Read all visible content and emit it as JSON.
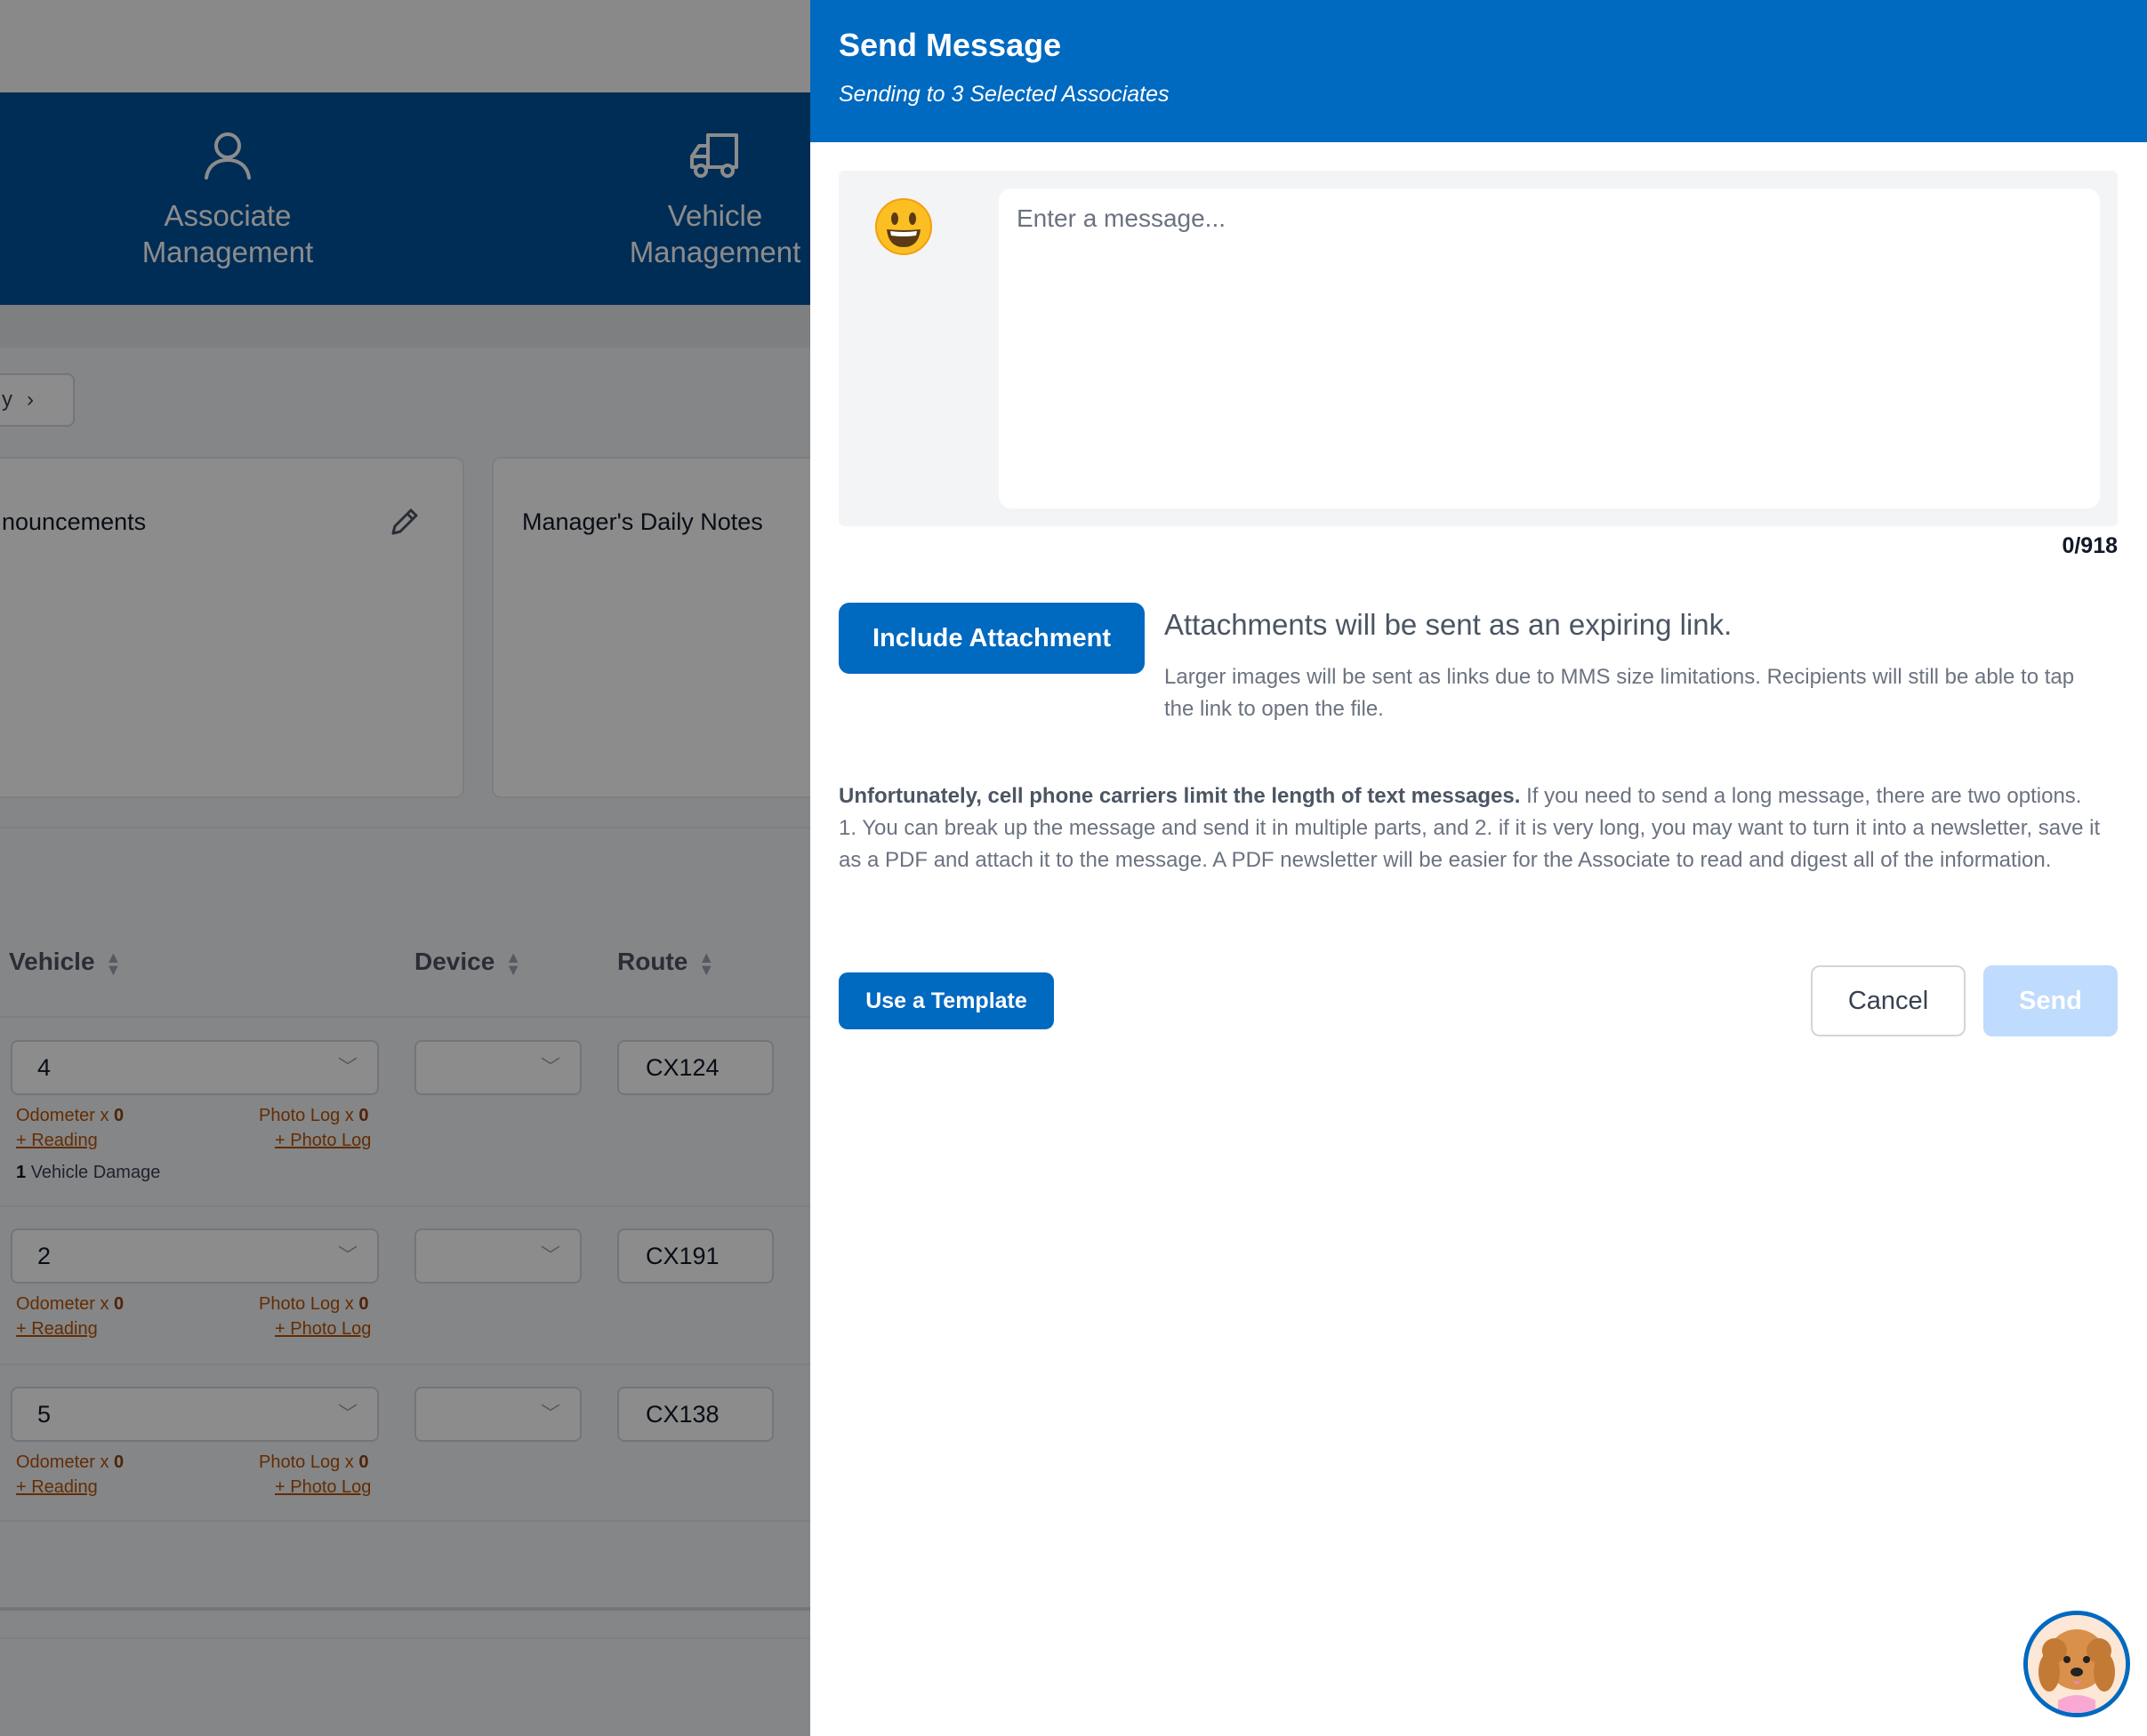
{
  "background": {
    "nav": [
      {
        "label": "Associate\nManagement",
        "icon": "user-icon"
      },
      {
        "label": "Vehicle\nManagement",
        "icon": "truck-icon"
      }
    ],
    "breadcrumb": {
      "label": "y",
      "chevron": "›"
    },
    "cards": [
      {
        "title": "nouncements"
      },
      {
        "title": "Manager's Daily Notes"
      }
    ],
    "table": {
      "headers": [
        "Vehicle",
        "Device",
        "Route"
      ],
      "rows": [
        {
          "vehicle": "4",
          "route": "CX124",
          "odometer_label": "Odometer x",
          "odometer_count": "0",
          "photo_label": "Photo Log x",
          "photo_count": "0",
          "reading_link": "+ Reading",
          "photo_link": "+ Photo Log",
          "damage_count": "1",
          "damage_label": "Vehicle Damage"
        },
        {
          "vehicle": "2",
          "route": "CX191",
          "odometer_label": "Odometer x",
          "odometer_count": "0",
          "photo_label": "Photo Log x",
          "photo_count": "0",
          "reading_link": "+ Reading",
          "photo_link": "+ Photo Log"
        },
        {
          "vehicle": "5",
          "route": "CX138",
          "odometer_label": "Odometer x",
          "odometer_count": "0",
          "photo_label": "Photo Log x",
          "photo_count": "0",
          "reading_link": "+ Reading",
          "photo_link": "+ Photo Log"
        }
      ]
    }
  },
  "drawer": {
    "title": "Send Message",
    "subtitle": "Sending to 3 Selected Associates",
    "message": {
      "placeholder": "Enter a message...",
      "value": "",
      "counter": "0/918",
      "emoji_icon": "smiley-face-icon"
    },
    "attachment": {
      "button_label": "Include Attachment",
      "title": "Attachments will be sent as an expiring link.",
      "description": "Larger images will be sent as links due to MMS size limitations. Recipients will still be able to tap the link to open the file."
    },
    "limit_note": {
      "bold": "Unfortunately, cell phone carriers limit the length of text messages.",
      "text": " If you need to send a long message, there are two options. 1. You can break up the message and send it in multiple parts, and 2. if it is very long, you may want to turn it into a newsletter, save it as a PDF and attach it to the message. A PDF newsletter will be easier for the Associate to read and digest all of the information."
    },
    "template_button": "Use a Template",
    "cancel_button": "Cancel",
    "send_button": "Send",
    "helper_avatar_icon": "dog-avatar-icon"
  },
  "colors": {
    "drawer_header": "#0069c0",
    "nav_background": "#00529b",
    "primary_button": "#0069c0",
    "send_disabled": "#bfdbfe",
    "meta_text": "#b45309"
  }
}
